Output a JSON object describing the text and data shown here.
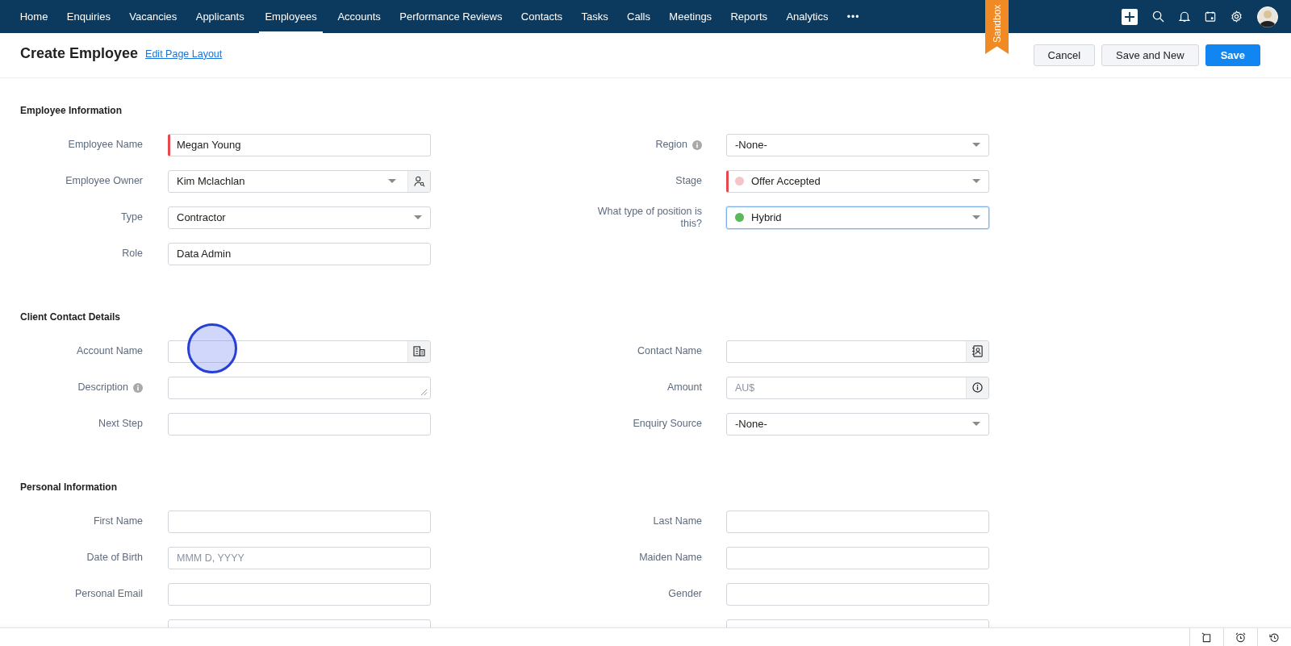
{
  "nav": {
    "items": [
      {
        "label": "Home",
        "selected": false
      },
      {
        "label": "Enquiries",
        "selected": false
      },
      {
        "label": "Vacancies",
        "selected": false
      },
      {
        "label": "Applicants",
        "selected": false
      },
      {
        "label": "Employees",
        "selected": true
      },
      {
        "label": "Accounts",
        "selected": false
      },
      {
        "label": "Performance Reviews",
        "selected": false
      },
      {
        "label": "Contacts",
        "selected": false
      },
      {
        "label": "Tasks",
        "selected": false
      },
      {
        "label": "Calls",
        "selected": false
      },
      {
        "label": "Meetings",
        "selected": false
      },
      {
        "label": "Reports",
        "selected": false
      },
      {
        "label": "Analytics",
        "selected": false
      }
    ],
    "more": "•••"
  },
  "header": {
    "title": "Create Employee",
    "link": "Edit Page Layout",
    "sandbox": "Sandbox",
    "buttons": [
      {
        "label": "Cancel",
        "kind": "secondary"
      },
      {
        "label": "Save and New",
        "kind": "secondary"
      },
      {
        "label": "Save",
        "kind": "primary"
      }
    ]
  },
  "sections": [
    {
      "title": "Employee Information",
      "left": [
        {
          "label": "Employee Name",
          "kind": "text",
          "value": "Megan Young",
          "required": true,
          "focused": false,
          "info": false
        },
        {
          "label": "Employee Owner",
          "kind": "user-lookup",
          "value": "Kim Mclachlan",
          "required": false,
          "focused": false,
          "info": false
        },
        {
          "label": "Type",
          "kind": "select",
          "value": "Contractor",
          "required": false,
          "focused": false,
          "info": false
        },
        {
          "label": "Role",
          "kind": "text",
          "value": "Data Admin",
          "required": false,
          "focused": false,
          "info": false
        }
      ],
      "right": [
        {
          "label": "Region",
          "kind": "select",
          "value": "-None-",
          "required": false,
          "focused": false,
          "info": true
        },
        {
          "label": "Stage",
          "kind": "select",
          "value": "Offer Accepted",
          "color": "#f6c4c4",
          "required": true,
          "focused": false,
          "info": false
        },
        {
          "label": "What type of position is this?",
          "kind": "select",
          "value": "Hybrid",
          "color": "#5cb85c",
          "required": false,
          "focused": true,
          "info": false
        }
      ]
    },
    {
      "title": "Client Contact Details",
      "left": [
        {
          "label": "Account Name",
          "kind": "account-lookup",
          "required": false,
          "focused": false,
          "info": false
        },
        {
          "label": "Description",
          "kind": "textarea",
          "required": false,
          "focused": false,
          "info": true
        },
        {
          "label": "Next Step",
          "kind": "text",
          "required": false,
          "focused": false,
          "info": false
        }
      ],
      "right": [
        {
          "label": "Contact Name",
          "kind": "contact-lookup",
          "required": false,
          "focused": false,
          "info": false
        },
        {
          "label": "Amount",
          "kind": "currency",
          "placeholder": "AU$",
          "required": false,
          "focused": false,
          "info": false
        },
        {
          "label": "Enquiry Source",
          "kind": "select",
          "value": "-None-",
          "required": false,
          "focused": false,
          "info": false
        }
      ]
    },
    {
      "title": "Personal Information",
      "left": [
        {
          "label": "First Name",
          "kind": "text",
          "required": false,
          "focused": false,
          "info": false
        },
        {
          "label": "Date of Birth",
          "kind": "text",
          "placeholder": "MMM D, YYYY",
          "required": false,
          "focused": false,
          "info": false
        },
        {
          "label": "Personal Email",
          "kind": "text",
          "required": false,
          "focused": false,
          "info": false
        },
        {
          "kind": "text"
        }
      ],
      "right": [
        {
          "label": "Last Name",
          "kind": "text",
          "required": false,
          "focused": false,
          "info": false
        },
        {
          "label": "Maiden Name",
          "kind": "text",
          "required": false,
          "focused": false,
          "info": false
        },
        {
          "label": "Gender",
          "kind": "text",
          "required": false,
          "focused": false,
          "info": false
        },
        {
          "kind": "text"
        }
      ]
    }
  ]
}
